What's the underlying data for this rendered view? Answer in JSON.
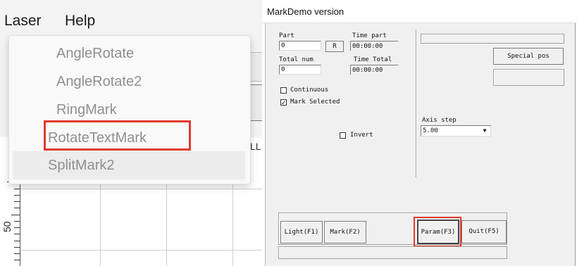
{
  "menubar": {
    "laser": "Laser",
    "help": "Help"
  },
  "dropdown": {
    "items": [
      "AngleRotate",
      "AngleRotate2",
      "RingMark",
      "RotateTextMark",
      "SplitMark2"
    ],
    "highlighted": "RotateTextMark"
  },
  "ruler": {
    "label": "50"
  },
  "stub_text": "LL",
  "dialog": {
    "title": "MarkDemo version",
    "part_label": "Part",
    "part_value": "0",
    "r_button": "R",
    "time_part_label": "Time part",
    "time_part_value": "00:00:00",
    "total_num_label": "Total num",
    "total_num_value": "0",
    "time_total_label": "Time Total",
    "time_total_value": "00:00:00",
    "continuous_label": "Continuous",
    "continuous_checked": false,
    "mark_selected_label": "Mark Selected",
    "mark_selected_checked": true,
    "invert_label": "Invert",
    "invert_checked": false,
    "special_pos_button": "Special pos",
    "axis_step_label": "Axis step",
    "axis_step_value": "5.00",
    "buttons": {
      "light": "Light(F1)",
      "mark": "Mark(F2)",
      "param": "Param(F3)",
      "quit": "Quit(F5)"
    }
  },
  "colors": {
    "highlight": "#e03a2f",
    "dialog_bg": "#f0f0f0",
    "menu_text_disabled": "#8f8f8f"
  }
}
